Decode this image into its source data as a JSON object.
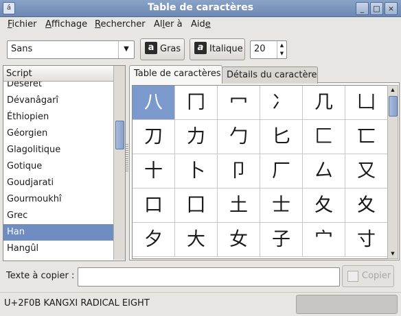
{
  "window": {
    "title": "Table de caractères",
    "menu_glyph": "á",
    "buttons": [
      "_",
      "□",
      "×"
    ]
  },
  "menubar": [
    {
      "label": "Fichier",
      "accel": "F",
      "rest": "ichier"
    },
    {
      "label": "Affichage",
      "accel": "A",
      "rest": "ffichage"
    },
    {
      "label": "Rechercher",
      "accel": "R",
      "rest": "echercher"
    },
    {
      "pre": "Al",
      "accel": "l",
      "label": "Aller à",
      "rest": "er à"
    },
    {
      "pre": "Aid",
      "accel": "e",
      "label": "Aide",
      "rest": ""
    }
  ],
  "toolbar": {
    "font_value": "Sans",
    "bold_label": "Gras",
    "bold_icon": "a",
    "italic_label": "Italique",
    "italic_icon": "a",
    "size_value": "20"
  },
  "script_list": {
    "header": "Script",
    "items": [
      "Déséret",
      "Dévanâgarî",
      "Éthiopien",
      "Géorgien",
      "Glagolitique",
      "Gotique",
      "Goudjarati",
      "Gourmoukhî",
      "Grec",
      "Han",
      "Hangûl"
    ],
    "selected": "Han"
  },
  "tabs": [
    {
      "label": "Table de caractères",
      "active": true
    },
    {
      "label": "Détails du caractère",
      "active": false
    }
  ],
  "char_grid": [
    [
      "八",
      "冂",
      "冖",
      "冫",
      "几",
      "凵"
    ],
    [
      "刀",
      "力",
      "勹",
      "匕",
      "匚",
      "匸"
    ],
    [
      "十",
      "卜",
      "卩",
      "厂",
      "厶",
      "又"
    ],
    [
      "口",
      "囗",
      "土",
      "士",
      "夂",
      "夊"
    ],
    [
      "夕",
      "大",
      "女",
      "子",
      "宀",
      "寸"
    ]
  ],
  "copy": {
    "label": "Texte à copier :",
    "value": "",
    "button_label": "Copier"
  },
  "status": {
    "text": "U+2F0B KANGXI RADICAL EIGHT"
  }
}
